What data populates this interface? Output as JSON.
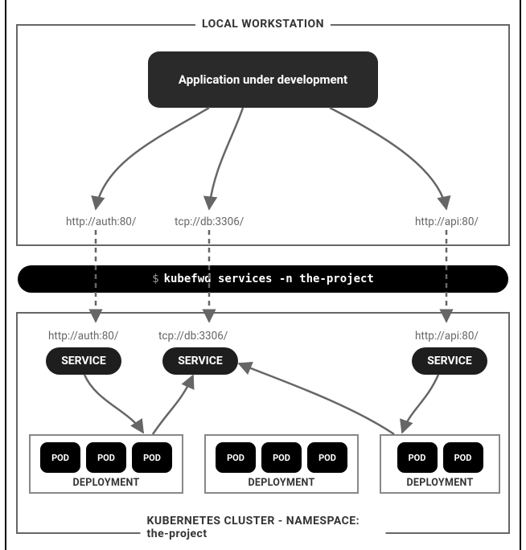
{
  "local": {
    "label": "LOCAL WORKSTATION",
    "app_label": "Application under development",
    "urls": {
      "auth": "http://auth:80/",
      "db": "tcp://db:3306/",
      "api": "http://api:80/"
    }
  },
  "command": {
    "prompt": "$",
    "text": "kubefwd services -n the-project"
  },
  "cluster": {
    "label": "KUBERNETES CLUSTER - NAMESPACE: the-project",
    "urls": {
      "auth": "http://auth:80/",
      "db": "tcp://db:3306/",
      "api": "http://api:80/"
    },
    "service_label": "SERVICE",
    "deployment_label": "DEPLOYMENT",
    "pod_label": "POD",
    "services": [
      {
        "name": "auth",
        "pods": 3
      },
      {
        "name": "db",
        "pods": 3
      },
      {
        "name": "api",
        "pods": 2
      }
    ]
  }
}
